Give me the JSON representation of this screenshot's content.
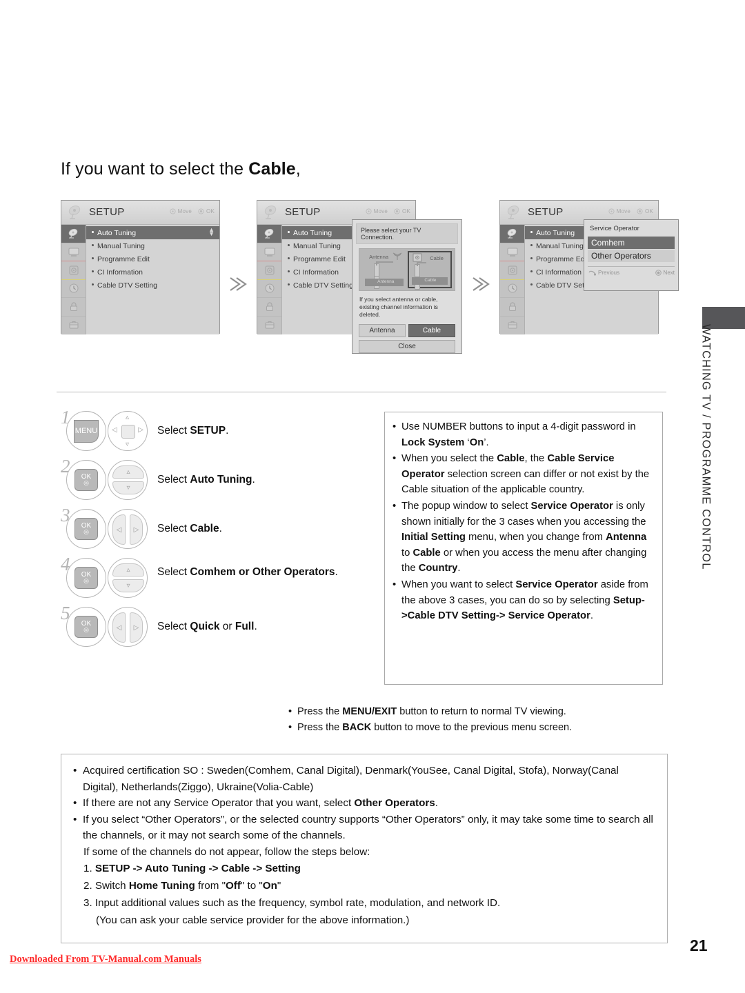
{
  "heading": {
    "pre": "If you want to select the ",
    "bold": "Cable",
    "post": ","
  },
  "osd": {
    "title": "SETUP",
    "hint_move": "Move",
    "hint_ok": "OK",
    "items": [
      "Auto Tuning",
      "Manual Tuning",
      "Programme Edit",
      "CI Information",
      "Cable DTV Setting"
    ],
    "items_truncated_2": [
      "Auto Tuning",
      "Manual Tuning",
      "Programme Edit",
      "CI Information",
      "Cable DTV Setting"
    ],
    "items_truncated_3": [
      "Auto Tuning",
      "Manual Tuning",
      "Programme Edi",
      "CI Information",
      "Cable DTV Sett"
    ],
    "side_icons": [
      "satellite-dish-icon",
      "tv-picture-icon",
      "audio-speaker-icon",
      "clock-time-icon",
      "lock-icon",
      "setup-briefcase-icon"
    ]
  },
  "popup_connection": {
    "title": "Please select your TV Connection.",
    "label_antenna": "Antenna",
    "label_cable": "Cable",
    "bar_antenna": "Antenna",
    "bar_cable": "Cable",
    "note": "If you select antenna or cable, existing channel information is deleted.",
    "btn_antenna": "Antenna",
    "btn_cable": "Cable",
    "btn_close": "Close"
  },
  "popup_service_operator": {
    "title": "Service Operator",
    "options": [
      "Comhem",
      "Other Operators"
    ],
    "selected": "Comhem",
    "previous": "Previous",
    "next": "Next"
  },
  "steps": [
    {
      "num": "1",
      "key": "MENU",
      "nav": "nav4",
      "text_pre": "Select ",
      "text_bold": "SETUP",
      "text_post": "."
    },
    {
      "num": "2",
      "key": "OK",
      "nav": "navud",
      "text_pre": "Select ",
      "text_bold": "Auto Tuning",
      "text_post": "."
    },
    {
      "num": "3",
      "key": "OK",
      "nav": "navlr",
      "text_pre": "Select ",
      "text_bold": "Cable",
      "text_post": "."
    },
    {
      "num": "4",
      "key": "OK",
      "nav": "navud",
      "text_pre": "Select ",
      "text_bold": "Comhem or Other Operators",
      "text_post": "."
    },
    {
      "num": "5",
      "key": "OK",
      "nav": "navlr",
      "text_pre": "Select ",
      "text_bold": "Quick",
      "text_mid": " or ",
      "text_bold2": "Full",
      "text_post": "."
    }
  ],
  "info_bullets": [
    "Use NUMBER buttons to input a 4-digit password in <b>Lock System</b> ‘<b>On</b>’.",
    "When you select the <b>Cable</b>, the <b>Cable Service Operator</b> selection screen can differ or not exist by the Cable situation of the applicable country.",
    "The popup window to select <b>Service Operator</b> is only shown initially for the 3 cases when you accessing the <b>Initial Setting</b> menu, when you change from <b>Antenna</b> to <b>Cable</b> or when you access the menu after changing the <b>Country</b>.",
    "When you want to select <b>Service Operator</b> aside from the above 3 cases, you can do so by selecting <b>Setup-&gt;Cable DTV Setting-&gt; Service Operator</b>."
  ],
  "press_lines": [
    "Press the <b>MENU/EXIT</b> button to return to normal TV viewing.",
    "Press the <b>BACK</b> button to move to the previous menu screen."
  ],
  "note_box": {
    "bullets": [
      "Acquired certification SO : Sweden(Comhem, Canal Digital), Denmark(YouSee, Canal Digital, Stofa), Norway(Canal Digital), Netherlands(Ziggo), Ukraine(Volia-Cable)",
      "If there are not any Service Operator that you want, select <b>Other Operators</b>.",
      "If you select “Other Operators”, or the selected country supports “Other Operators” only, it may take some time to search all the channels, or it may not search some of the channels."
    ],
    "sub": "If some of the channels do not appear, follow the steps below:",
    "numbered": [
      "1. <b>SETUP -&gt; Auto Tuning -&gt; Cable -&gt; Setting</b>",
      "2. Switch <b>Home Tuning</b>  from \"<b>Off</b>\" to \"<b>On</b>\"",
      "3. Input additional values such as the frequency, symbol rate, modulation, and network ID.",
      "(You can ask your cable service provider for the above information.)"
    ]
  },
  "side_tab_text": "WATCHING TV / PROGRAMME CONTROL",
  "page_number": "21",
  "footer_link": "Downloaded From TV-Manual.com Manuals",
  "colors": {
    "accent_red": "#ff2a2a",
    "osd_bg": "#d4d4d4",
    "osd_sel": "#6e6e6e",
    "side_tab": "#565659"
  }
}
